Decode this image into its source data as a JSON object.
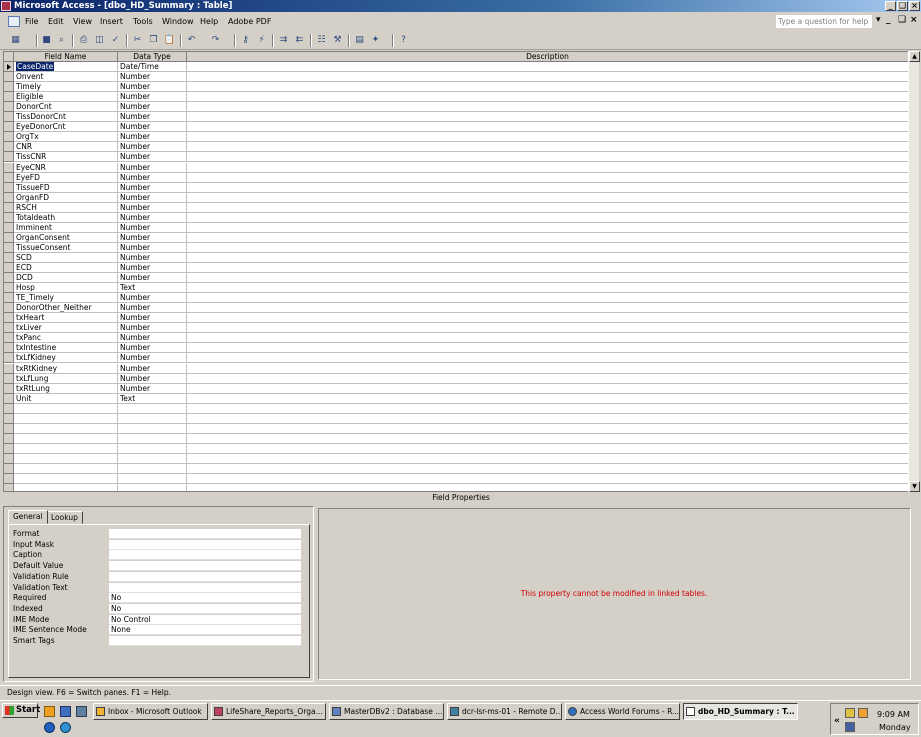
{
  "window": {
    "title": "Microsoft Access - [dbo_HD_Summary : Table]"
  },
  "menu": {
    "items": [
      "File",
      "Edit",
      "View",
      "Insert",
      "Tools",
      "Window",
      "Help",
      "Adobe PDF"
    ]
  },
  "help": {
    "placeholder": "Type a question for help"
  },
  "grid": {
    "headers": {
      "field_name": "Field Name",
      "data_type": "Data Type",
      "description": "Description"
    },
    "rows": [
      {
        "name": "CaseDate",
        "type": "Date/Time"
      },
      {
        "name": "Onvent",
        "type": "Number"
      },
      {
        "name": "Timely",
        "type": "Number"
      },
      {
        "name": "Eligible",
        "type": "Number"
      },
      {
        "name": "DonorCnt",
        "type": "Number"
      },
      {
        "name": "TissDonorCnt",
        "type": "Number"
      },
      {
        "name": "EyeDonorCnt",
        "type": "Number"
      },
      {
        "name": "OrgTx",
        "type": "Number"
      },
      {
        "name": "CNR",
        "type": "Number"
      },
      {
        "name": "TissCNR",
        "type": "Number"
      },
      {
        "name": "EyeCNR",
        "type": "Number"
      },
      {
        "name": "EyeFD",
        "type": "Number"
      },
      {
        "name": "TissueFD",
        "type": "Number"
      },
      {
        "name": "OrganFD",
        "type": "Number"
      },
      {
        "name": "RSCH",
        "type": "Number"
      },
      {
        "name": "Totaldeath",
        "type": "Number"
      },
      {
        "name": "Imminent",
        "type": "Number"
      },
      {
        "name": "OrganConsent",
        "type": "Number"
      },
      {
        "name": "TissueConsent",
        "type": "Number"
      },
      {
        "name": "SCD",
        "type": "Number"
      },
      {
        "name": "ECD",
        "type": "Number"
      },
      {
        "name": "DCD",
        "type": "Number"
      },
      {
        "name": "Hosp",
        "type": "Text"
      },
      {
        "name": "TE_Timely",
        "type": "Number"
      },
      {
        "name": "DonorOther_Neither",
        "type": "Number"
      },
      {
        "name": "txHeart",
        "type": "Number"
      },
      {
        "name": "txLiver",
        "type": "Number"
      },
      {
        "name": "txPanc",
        "type": "Number"
      },
      {
        "name": "txIntestine",
        "type": "Number"
      },
      {
        "name": "txLfKidney",
        "type": "Number"
      },
      {
        "name": "txRtKidney",
        "type": "Number"
      },
      {
        "name": "txLfLung",
        "type": "Number"
      },
      {
        "name": "txRtLung",
        "type": "Number"
      },
      {
        "name": "Unit",
        "type": "Text"
      }
    ]
  },
  "field_properties": {
    "title": "Field Properties",
    "tabs": [
      "General",
      "Lookup"
    ],
    "props": [
      {
        "label": "Format",
        "value": ""
      },
      {
        "label": "Input Mask",
        "value": ""
      },
      {
        "label": "Caption",
        "value": ""
      },
      {
        "label": "Default Value",
        "value": ""
      },
      {
        "label": "Validation Rule",
        "value": ""
      },
      {
        "label": "Validation Text",
        "value": ""
      },
      {
        "label": "Required",
        "value": "No"
      },
      {
        "label": "Indexed",
        "value": "No"
      },
      {
        "label": "IME Mode",
        "value": "No Control"
      },
      {
        "label": "IME Sentence Mode",
        "value": "None"
      },
      {
        "label": "Smart Tags",
        "value": ""
      }
    ],
    "message": "This property cannot be modified in linked tables."
  },
  "status": {
    "text": "Design view.  F6 = Switch panes.  F1 = Help."
  },
  "taskbar": {
    "start": "Start",
    "buttons": [
      "Inbox - Microsoft Outlook",
      "LifeShare_Reports_Orga...",
      "MasterDBv2 : Database ...",
      "dcr-lsr-ms-01 - Remote D...",
      "Access World Forums - R...",
      "dbo_HD_Summary : T..."
    ],
    "clock": "9:09 AM",
    "day": "Monday"
  }
}
